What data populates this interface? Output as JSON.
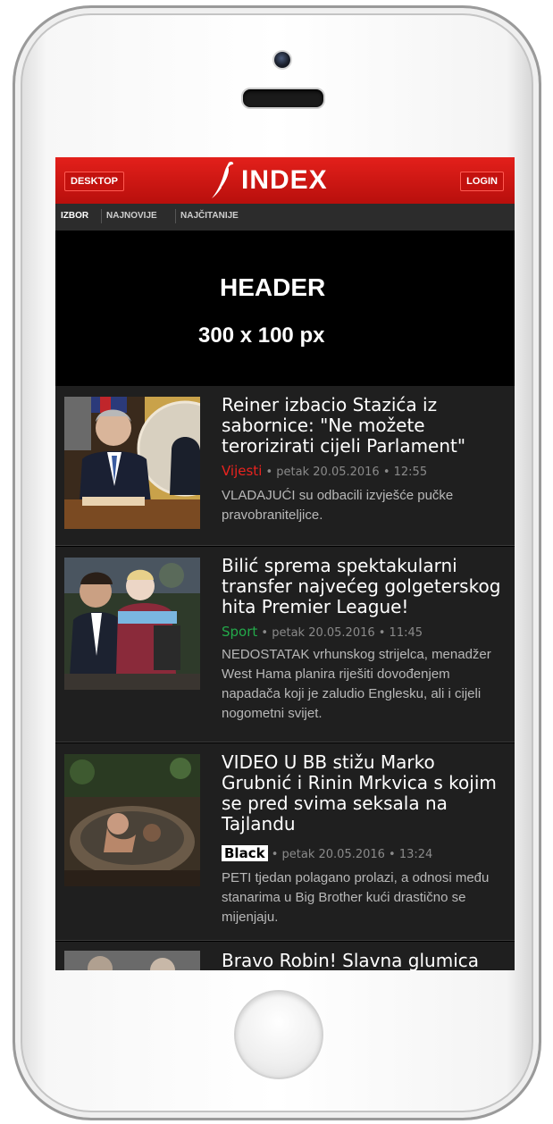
{
  "header": {
    "desktop_label": "DESKTOP",
    "logo_text": "INDEX",
    "login_label": "LOGIN",
    "nav": [
      "IZBOR",
      "NAJNOVIJE",
      "NAJČITANIJE"
    ]
  },
  "ad": {
    "line1": "HEADER",
    "line2": "300 x 100 px"
  },
  "articles": [
    {
      "title": "Reiner izbacio Stazića iz sabornice: \"Ne možete terorizirati cijeli Parlament\"",
      "category": "Vijesti",
      "date": "• petak 20.05.2016 • 12:55",
      "desc": "VLADAJUĆI su odbacili izvješće pučke pravobraniteljice."
    },
    {
      "title": "Bilić sprema spektakularni transfer najvećeg golgeterskog hita Premier League!",
      "category": "Sport",
      "date": "• petak 20.05.2016 • 11:45",
      "desc": "NEDOSTATAK vrhunskog strijelca, menadžer West Hama planira riješiti dovođenjem napadača koji je zaludio Englesku, ali i cijeli nogometni svijet."
    },
    {
      "title": "VIDEO U BB stižu Marko Grubnić i Rinin Mrkvica s kojim se pred svima seksala na Tajlandu",
      "category": "Black",
      "date": "• petak 20.05.2016 • 13:24",
      "desc": "PETI tjedan polagano prolazi, a odnosi među stanarima u Big Brother kući drastično se mijenjaju."
    },
    {
      "title": "Bravo Robin! Slavna glumica"
    }
  ],
  "colors": {
    "brand_red": "#e3201b",
    "vijesti": "#e8231f",
    "sport": "#23a94a"
  }
}
